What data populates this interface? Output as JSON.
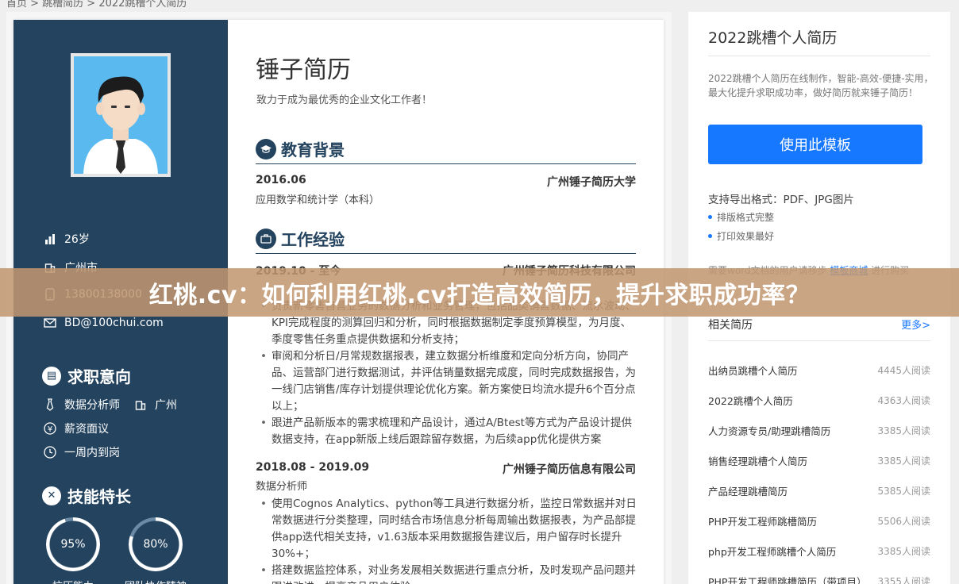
{
  "breadcrumb": "首页 > 跳槽简历 > 2022跳槽个人简历",
  "resume": {
    "name": "锤子简历",
    "motto": "致力于成为最优秀的企业文化工作者！",
    "side": {
      "age": "26岁",
      "city": "广州市",
      "phone": "13800138000",
      "email": "BD@100chui.com",
      "intent_title": "求职意向",
      "intent_job": "数据分析师",
      "intent_city": "广州",
      "intent_salary": "薪资面议",
      "intent_arrival": "一周内到岗",
      "skills_title": "技能特长",
      "skills": [
        {
          "percent": "95%",
          "value": 0.95,
          "label": "抗压能力"
        },
        {
          "percent": "80%",
          "value": 0.8,
          "label": "团队协作精神"
        }
      ]
    },
    "education": {
      "title": "教育背景",
      "date": "2016.06",
      "school": "广州锤子简历大学",
      "major": "应用数学和统计学（本科）"
    },
    "work": {
      "title": "工作经验",
      "jobs": [
        {
          "date": "2019.10 - 至今",
          "company": "广州锤子简历科技有限公司",
          "bullets": [
            "负责新零售自营业务的数据分析和业务管理，包括品类销售数据、流水波动、KPI完成程度的测算回归和分析，同时根据数据制定季度预算模型，为月度、季度零售任务重点提供数据和分析支持；",
            "审阅和分析日/月常规数据报表，建立数据分析维度和定向分析方向，协同产品、运营部门进行数据测试，并评估销量数据完成度，同时完成数据报告，为一线门店销售/库存计划提供理论优化方案。新方案使日均流水提升6个百分点以上；",
            "跟进产品新版本的需求梳理和产品设计，通过A/Btest等方式为产品设计提供数据支持，在app新版上线后跟踪留存数据，为后续app优化提供方案"
          ]
        },
        {
          "date": "2018.08 - 2019.09",
          "company": "广州锤子简历信息有限公司",
          "role": "数据分析师",
          "bullets": [
            "使用Cognos Analytics、python等工具进行数据分析，监控日常数据并对日常数据进行分类整理，同时结合市场信息分析每周输出数据报表，为产品部提供app迭代相关支持，v1.63版本采用数据报告建议后，用户留存时长提升30%+；",
            "搭建数据监控体系，对业务发展相关数据进行重点分析，及时发现产品问题并跟进改进，提高产品用户体验"
          ]
        }
      ]
    }
  },
  "sidebar": {
    "title": "2022跳槽个人简历",
    "desc": "2022跳槽个人简历在线制作，智能-高效-便捷-实用，最大化提升求职成功率，做好简历就来锤子简历！",
    "use_button": "使用此模板",
    "support": "支持导出格式：PDF、JPG图片",
    "features": [
      "排版格式完整",
      "打印效果最好"
    ],
    "note_prefix": "需要word文档的用户请移步",
    "note_link": "模板商城",
    "note_suffix": "进行购买",
    "related_title": "相关简历",
    "related_more": "更多>",
    "related": [
      {
        "name": "出纳员跳槽个人简历",
        "views": "4445人阅读"
      },
      {
        "name": "2022跳槽个人简历",
        "views": "4363人阅读"
      },
      {
        "name": "人力资源专员/助理跳槽简历",
        "views": "3385人阅读"
      },
      {
        "name": "销售经理跳槽个人简历",
        "views": "3385人阅读"
      },
      {
        "name": "产品经理跳槽简历",
        "views": "5385人阅读"
      },
      {
        "name": "PHP开发工程师跳槽简历",
        "views": "5506人阅读"
      },
      {
        "name": "php开发工程师跳槽个人简历",
        "views": "3385人阅读"
      },
      {
        "name": "PHP开发工程师跳槽简历（带项目）",
        "views": "3355人阅读"
      }
    ]
  },
  "banner": "红桃.cv：如何利用红桃.cv打造高效简历，提升求职成功率？",
  "colors": {
    "resume_side": "#24435f",
    "accent_blue": "#1677ff",
    "banner": "#c19670"
  }
}
